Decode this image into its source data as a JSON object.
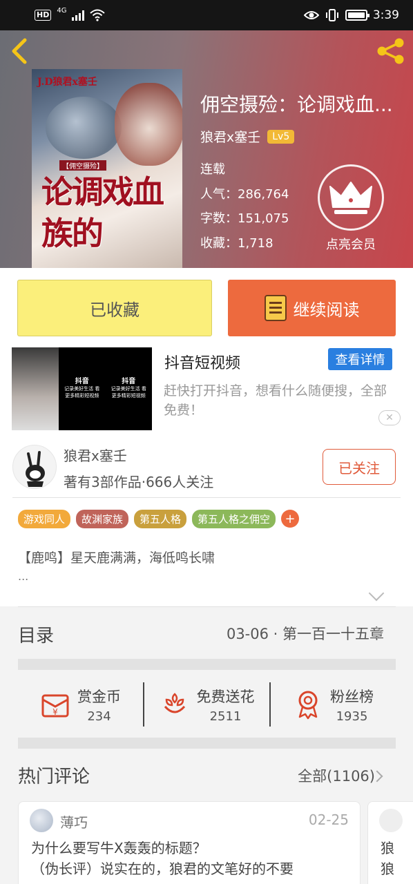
{
  "status_bar": {
    "hd": "HD",
    "network": "4G",
    "time": "3:39"
  },
  "book": {
    "cover_top_text": "J.D狼君x塞壬",
    "cover_sub_text": "【佣空摄殓】",
    "cover_title_text": "论调戏血族的",
    "title": "佣空摄殓：论调戏血...",
    "author": "狼君x塞壬",
    "level": "Lv5",
    "status": "连载",
    "popularity": "人气：286,764",
    "word_count": "字数：151,075",
    "favorites": "收藏：1,718"
  },
  "vip": {
    "label": "点亮会员"
  },
  "actions": {
    "favorited": "已收藏",
    "continue_reading": "继续阅读"
  },
  "ad": {
    "title": "抖音短视频",
    "button": "查看详情",
    "description": "赶快打开抖音，想看什么随便搜，全部免费！",
    "panel_text_1": "抖音",
    "panel_caption": "记录美好生活 看更多精彩短视频",
    "close": "✕"
  },
  "author_card": {
    "name": "狼君x塞壬",
    "meta": "著有3部作品·666人关注",
    "follow": "已关注"
  },
  "tags": [
    {
      "label": "游戏同人",
      "color": "#f2a93b"
    },
    {
      "label": "故渊家族",
      "color": "#c0645a"
    },
    {
      "label": "第五人格",
      "color": "#c9a03d"
    },
    {
      "label": "第五人格之佣空",
      "color": "#8cb85a"
    }
  ],
  "tag_more": "+",
  "intro": {
    "text": "【鹿鸣】星天鹿满满，海低鸣长啸",
    "more": "..."
  },
  "catalog": {
    "title": "目录",
    "latest": "03-06 · 第一百一十五章"
  },
  "rewards": [
    {
      "label": "赏金币",
      "count": "234",
      "icon": "red-envelope-icon"
    },
    {
      "label": "免费送花",
      "count": "2511",
      "icon": "flower-icon"
    },
    {
      "label": "粉丝榜",
      "count": "1935",
      "icon": "medal-icon"
    }
  ],
  "comments": {
    "title": "热门评论",
    "all": "全部(1106)",
    "first": {
      "user": "薄巧",
      "date": "02-25",
      "text_line1": "为什么要写牛X轰轰的标题？",
      "text_line2": "（伪长评）说实在的，狼君的文笔好的不要"
    },
    "second": {
      "line1": "狼",
      "line2": "狼"
    }
  }
}
